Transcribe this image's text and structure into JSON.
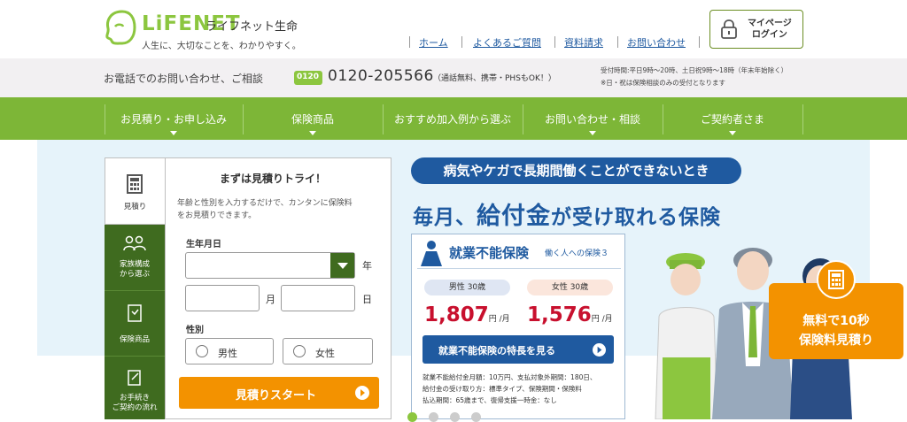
{
  "brand": {
    "logo_text": "LiFENET",
    "name_jp": "ライフネット生命",
    "tagline": "人生に、大切なことを、わかりやすく。",
    "accent": "#8cc63f"
  },
  "topnav": {
    "items": [
      "ホーム",
      "よくあるご質問",
      "資料請求",
      "お問い合わせ"
    ]
  },
  "mypage": {
    "line1": "マイページ",
    "line2": "ログイン"
  },
  "phonebar": {
    "lead": "お電話でのお問い合わせ、ご相談",
    "icon_text": "0120",
    "number": "0120-205566",
    "note": "（通話無料、携帯・PHSもOK！）",
    "hours1": "受付時間:平日9時〜20時、土日祝9時〜18時（年末年始除く）",
    "hours2": "※日・祝は保険相談のみの受付となります"
  },
  "gnav": {
    "color": "#7db637",
    "items": [
      "お見積り・お申し込み",
      "保険商品",
      "おすすめ加入例から選ぶ",
      "お問い合わせ・相談",
      "ご契約者さま"
    ]
  },
  "sidetabs": [
    {
      "label": "見積り",
      "icon": "calculator-icon"
    },
    {
      "label": "家族構成\nから選ぶ",
      "icon": "family-icon"
    },
    {
      "label": "保険商品",
      "icon": "product-icon"
    },
    {
      "label": "お手続き\nご契約の流れ",
      "icon": "document-icon"
    }
  ],
  "quote": {
    "title": "まずは見積りトライ！",
    "desc1": "年齢と性別を入力するだけで、カンタンに保険料",
    "desc2": "をお見積りできます。",
    "dob_label": "生年月日",
    "year_unit": "年",
    "month_unit": "月",
    "day_unit": "日",
    "gender_label": "性別",
    "male": "男性",
    "female": "女性",
    "start_button": "見積りスタート"
  },
  "promo": {
    "banner": "病気やケガで長期間働くことができないとき",
    "headline_a": "毎月、",
    "headline_b": "給付金",
    "headline_c": "が受け取れる保険"
  },
  "product_card": {
    "name": "就業不能保険",
    "subtitle": "働く人への保険３",
    "male_label": "男性 30歳",
    "male_price": "1,807",
    "female_label": "女性 30歳",
    "female_price": "1,576",
    "price_unit": "円 /月",
    "feature_button": "就業不能保険の特長を見る",
    "note1": "就業不能給付金月額：10万円、支払対象外期間：180日、",
    "note2": "給付金の受け取り方：標準タイプ、保険期間・保険料",
    "note3": "払込期間：65歳まで、復帰支援一時金：なし"
  },
  "cta": {
    "line1": "無料で10秒",
    "line2": "保険料見積り"
  },
  "carousel": {
    "dots": 4
  }
}
